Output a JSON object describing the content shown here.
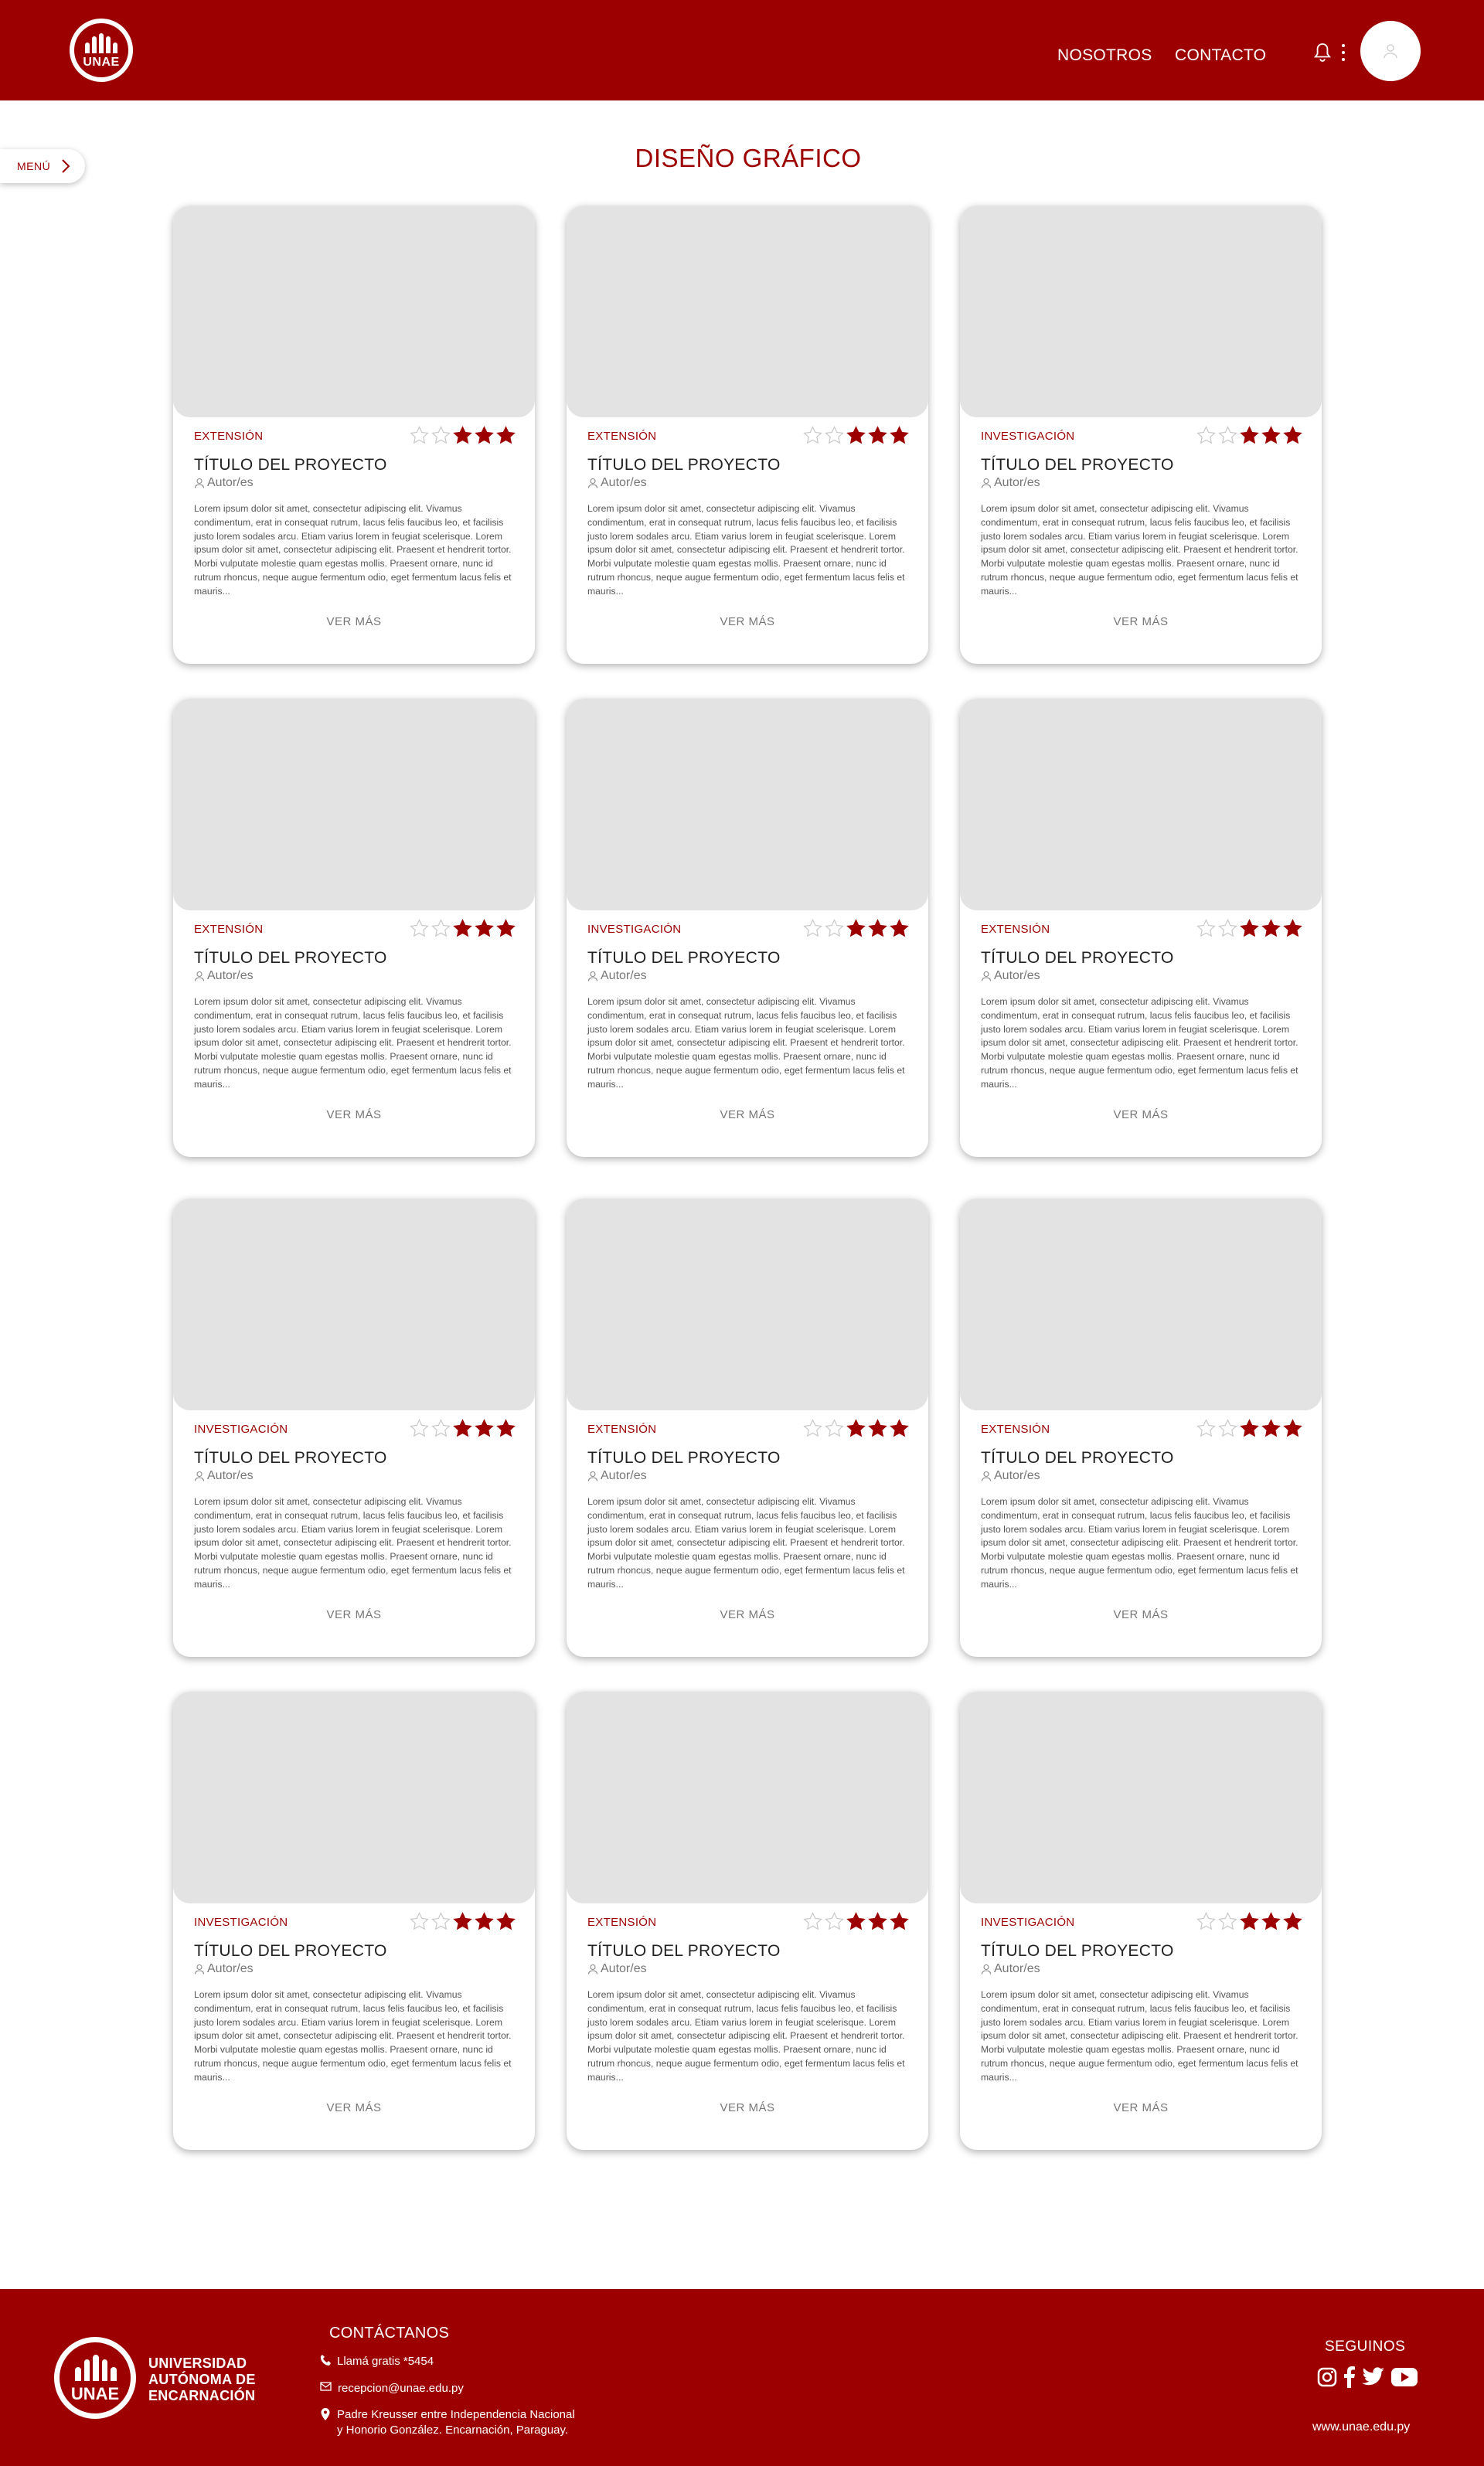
{
  "header": {
    "logo_text": "UNAE",
    "nav": [
      "NOSOTROS",
      "CONTACTO"
    ]
  },
  "menu": {
    "label": "MENÚ"
  },
  "page": {
    "title": "DISEÑO GRÁFICO"
  },
  "card_common": {
    "title": "TÍTULO DEL PROYECTO",
    "author": "Autor/es",
    "description": "Lorem ipsum dolor sit amet, consectetur adipiscing elit. Vivamus condimentum, erat in consequat rutrum, lacus felis faucibus leo, et facilisis justo lorem sodales arcu. Etiam varius lorem in feugiat scelerisque. Lorem ipsum dolor sit amet, consectetur adipiscing elit. Praesent et hendrerit tortor. Morbi vulputate molestie quam egestas mollis. Praesent ornare, nunc id rutrum rhoncus, neque augue fermentum odio, eget fermentum lacus felis et mauris...",
    "more": "VER MÁS",
    "rating": 3,
    "rating_max": 5
  },
  "cards": [
    {
      "category": "EXTENSIÓN"
    },
    {
      "category": "EXTENSIÓN"
    },
    {
      "category": "INVESTIGACIÓN"
    },
    {
      "category": "EXTENSIÓN"
    },
    {
      "category": "INVESTIGACIÓN"
    },
    {
      "category": "EXTENSIÓN"
    },
    {
      "category": "INVESTIGACIÓN"
    },
    {
      "category": "EXTENSIÓN"
    },
    {
      "category": "EXTENSIÓN"
    },
    {
      "category": "INVESTIGACIÓN"
    },
    {
      "category": "EXTENSIÓN"
    },
    {
      "category": "INVESTIGACIÓN"
    }
  ],
  "footer": {
    "logo_text": "UNAE",
    "university": [
      "UNIVERSIDAD",
      "AUTÓNOMA DE",
      "ENCARNACIÓN"
    ],
    "contact_title": "CONTÁCTANOS",
    "phone": "Llamá gratis *5454",
    "email": "recepcion@unae.edu.py",
    "address": [
      "Padre Kreusser entre Independencia Nacional",
      "y Honorio González. Encarnación, Paraguay."
    ],
    "follow": "SEGUINOS",
    "website": "www.unae.edu.py"
  },
  "colors": {
    "brand": "#9c0000",
    "placeholder": "#e3e3e3"
  },
  "icons": [
    "bell-icon",
    "more-vertical-icon",
    "user-icon",
    "chevron-right-icon",
    "star-icon",
    "phone-icon",
    "mail-icon",
    "location-icon",
    "instagram-icon",
    "facebook-icon",
    "twitter-icon",
    "youtube-icon"
  ]
}
